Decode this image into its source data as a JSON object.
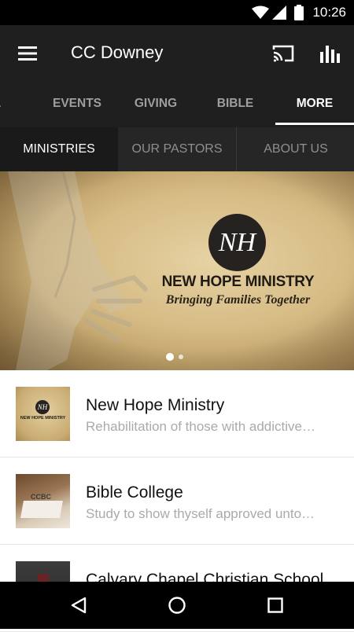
{
  "status_bar": {
    "time": "10:26"
  },
  "app_bar": {
    "title": "CC Downey",
    "menu_icon": "hamburger-icon",
    "cast_icon": "cast-icon",
    "stats_icon": "bar-chart-icon"
  },
  "tabs": [
    "DIA",
    "EVENTS",
    "GIVING",
    "BIBLE",
    "MORE"
  ],
  "active_tab": "MORE",
  "sub_tabs": [
    "MINISTRIES",
    "OUR PASTORS",
    "ABOUT US"
  ],
  "active_sub_tab": "MINISTRIES",
  "banner": {
    "logo_text": "NH",
    "title": "NEW HOPE MINISTRY",
    "subtitle": "Bringing Families Together",
    "slide_index": 1,
    "slide_count": 2
  },
  "list": [
    {
      "title": "New Hope Ministry",
      "subtitle": "Rehabilitation of those with addictive…",
      "thumb_text": "NEW HOPE MINISTRY"
    },
    {
      "title": "Bible College",
      "subtitle": "Study to show thyself approved unto…",
      "thumb_text": "CCBC"
    },
    {
      "title": "Calvary Chapel Christian School",
      "subtitle": ""
    }
  ],
  "nav_bar": {
    "back_icon": "back-icon",
    "home_icon": "home-icon",
    "recents_icon": "recents-icon"
  }
}
